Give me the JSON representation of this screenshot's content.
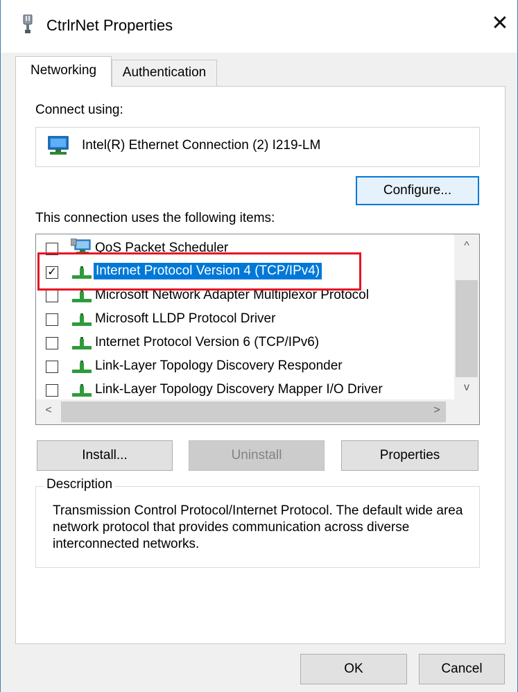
{
  "window": {
    "title": "CtrlrNet Properties",
    "close_glyph": "✕"
  },
  "tabs": [
    {
      "label": "Networking",
      "active": true
    },
    {
      "label": "Authentication",
      "active": false
    }
  ],
  "connect_using": {
    "label": "Connect using:",
    "adapter_name": "Intel(R) Ethernet Connection (2) I219-LM",
    "adapter_icon": "network-adapter-icon"
  },
  "buttons": {
    "configure": "Configure...",
    "install": "Install...",
    "uninstall": "Uninstall",
    "properties": "Properties",
    "ok": "OK",
    "cancel": "Cancel"
  },
  "items_label": "This connection uses the following items:",
  "items": [
    {
      "label": "QoS Packet Scheduler",
      "checked": false,
      "selected": false,
      "icon": "qos-scheduler-icon"
    },
    {
      "label": "Internet Protocol Version 4 (TCP/IPv4)",
      "checked": true,
      "selected": true,
      "icon": "protocol-icon"
    },
    {
      "label": "Microsoft Network Adapter Multiplexor Protocol",
      "checked": false,
      "selected": false,
      "icon": "protocol-icon"
    },
    {
      "label": "Microsoft LLDP Protocol Driver",
      "checked": false,
      "selected": false,
      "icon": "protocol-icon"
    },
    {
      "label": "Internet Protocol Version 6 (TCP/IPv6)",
      "checked": false,
      "selected": false,
      "icon": "protocol-icon"
    },
    {
      "label": "Link-Layer Topology Discovery Responder",
      "checked": false,
      "selected": false,
      "icon": "protocol-icon"
    },
    {
      "label": "Link-Layer Topology Discovery Mapper I/O Driver",
      "checked": false,
      "selected": false,
      "icon": "protocol-icon"
    }
  ],
  "scroll_glyphs": {
    "up": "^",
    "down": "v",
    "left": "<",
    "right": ">"
  },
  "description": {
    "title": "Description",
    "text": "Transmission Control Protocol/Internet Protocol. The default wide area network protocol that provides communication across diverse interconnected networks."
  },
  "colors": {
    "selection": "#0078d7",
    "annotation_frame": "#e81123",
    "window_border": "#3c7fb1"
  }
}
